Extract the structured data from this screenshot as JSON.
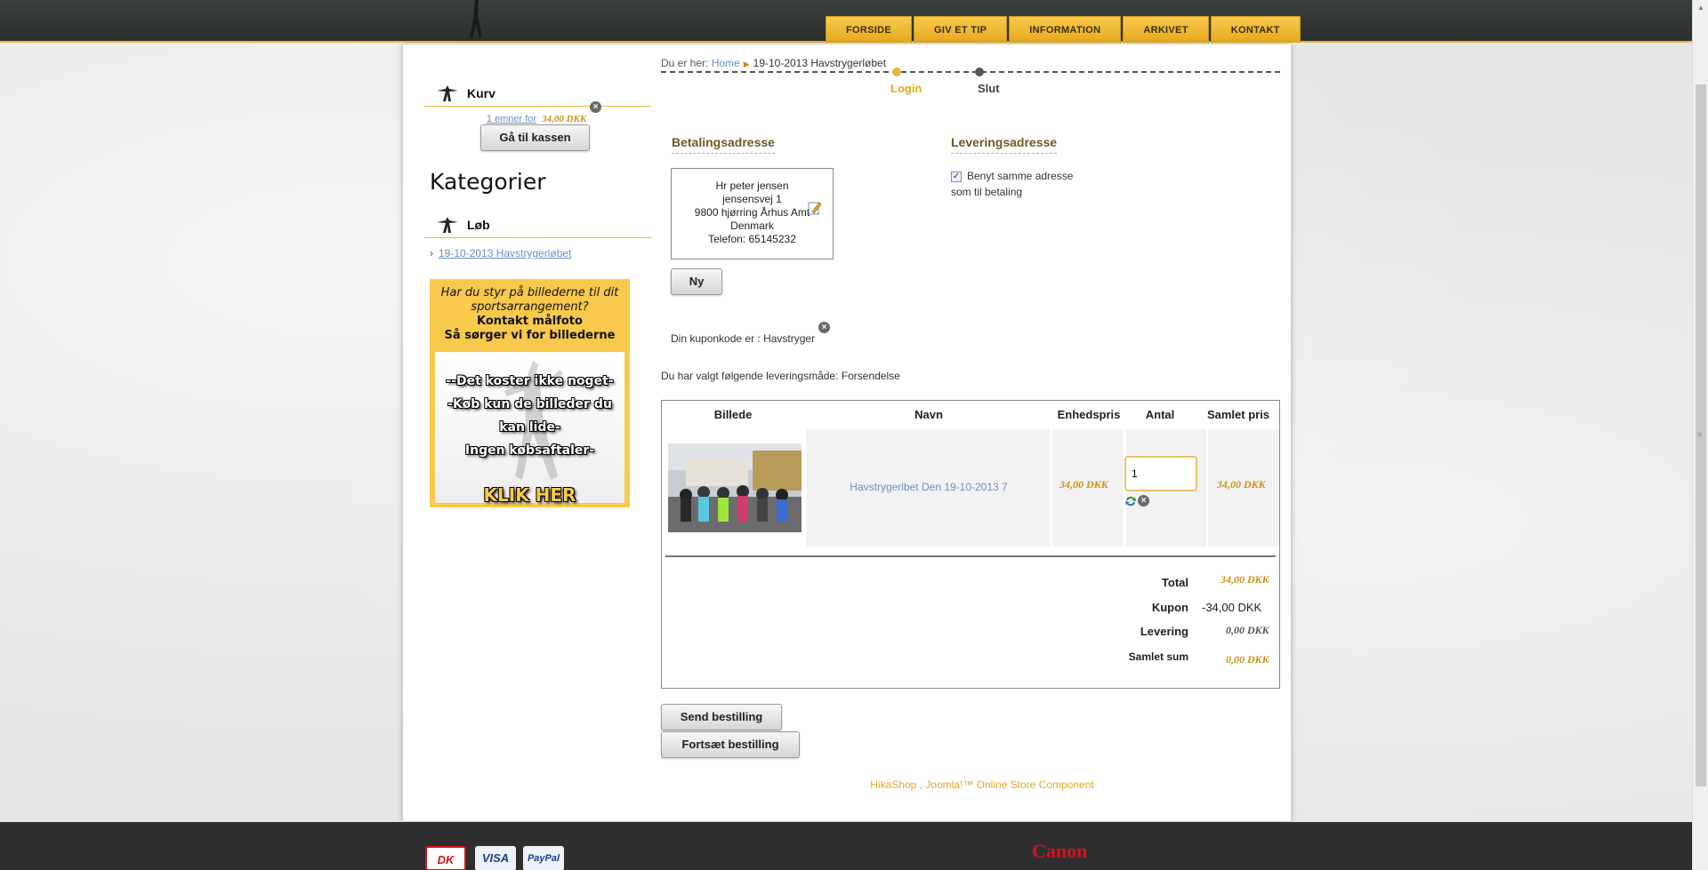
{
  "nav": {
    "items": [
      "FORSIDE",
      "GIV ET TIP",
      "INFORMATION",
      "ARKIVET",
      "KONTAKT"
    ]
  },
  "sidebar": {
    "cart_title": "Kurv",
    "cart_items_link": "1 emner for",
    "cart_price": "34,00 DKK",
    "checkout_button": "Gå til kassen",
    "categories_title": "Kategorier",
    "run_module_title": "Løb",
    "category_link": "19-10-2013 Havstrygerløbet",
    "ad": {
      "line1": "Har du styr på billederne til dit",
      "line2": "sportsarrangement?",
      "line3": "Kontakt målfoto",
      "line4": "Så sørger vi for billederne",
      "line5": "--Det koster ikke noget-",
      "line6": "-Køb kun de billeder du kan lide-",
      "line7": "Ingen købsaftaler-",
      "cta": "KLIK HER"
    }
  },
  "breadcrumb": {
    "label": "Du er her:",
    "home": "Home",
    "current": "19-10-2013 Havstrygerløbet"
  },
  "steps": {
    "login": "Login",
    "slut": "Slut"
  },
  "billing": {
    "title": "Betalingsadresse",
    "name": "Hr peter jensen",
    "street": "jensensvej 1",
    "city": "9800 hjørring Århus Amt",
    "country": "Denmark",
    "phone": "Telefon: 65145232",
    "new_button": "Ny"
  },
  "shipping": {
    "title": "Leveringsadresse",
    "same_address_line1": "Benyt samme adresse",
    "same_address_line2": "som til betaling",
    "checked": true
  },
  "coupon_text": "Din kuponkode er : Havstryger",
  "delivery_text": "Du har valgt følgende leveringsmåde: Forsendelse",
  "table": {
    "headers": [
      "Billede",
      "Navn",
      "Enhedspris",
      "Antal",
      "Samlet pris"
    ],
    "rows": [
      {
        "name": "Havstrygerlbet Den 19-10-2013 7",
        "unit_price": "34,00 DKK",
        "quantity": "1",
        "total": "34,00 DKK"
      }
    ]
  },
  "totals": {
    "total_label": "Total",
    "total_value": "34,00 DKK",
    "coupon_label": "Kupon",
    "coupon_value": "-34,00 DKK",
    "delivery_label": "Levering",
    "delivery_value": "0,00 DKK",
    "sum_label": "Samlet sum",
    "sum_value": "0,00 DKK"
  },
  "buttons": {
    "send": "Send bestilling",
    "continue": "Fortsæt bestilling"
  },
  "footer_credit": "HikaShop , Joomla!™ Online Store Component",
  "footer": {
    "dk_label": "DK",
    "visa_label": "VISA",
    "paypal_label": "PayPal",
    "canon_label": "Canon"
  },
  "colors": {
    "accent": "#e7b53b",
    "link": "#6a8fc3",
    "price": "#c99316"
  }
}
